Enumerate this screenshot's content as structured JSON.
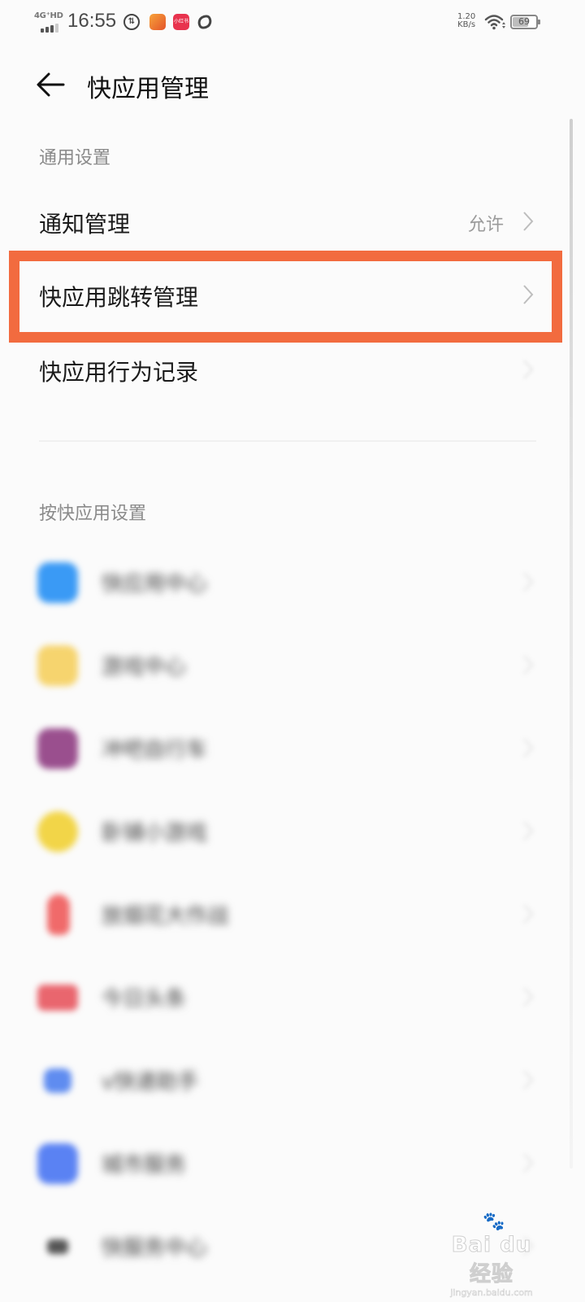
{
  "status_bar": {
    "network_label": "4G⁺HD",
    "time": "16:55",
    "speed_value": "1.20",
    "speed_unit": "KB/s",
    "battery_percent": 69,
    "battery_text": "69",
    "notification_icons": [
      "data-transfer-icon",
      "kuaishou-app-icon",
      "xiaohongshu-app-icon",
      "rugby-app-icon"
    ],
    "app2_label": "小红书"
  },
  "header": {
    "back_icon": "arrow-left-icon",
    "title": "快应用管理"
  },
  "general_section": {
    "label": "通用设置",
    "items": [
      {
        "label": "通知管理",
        "value": "允许"
      },
      {
        "label": "快应用跳转管理",
        "value": ""
      },
      {
        "label": "快应用行为记录",
        "value": ""
      }
    ]
  },
  "highlight": {
    "color": "#f26b3f",
    "target": "快应用跳转管理"
  },
  "apps_section": {
    "label": "按快应用设置",
    "apps": [
      {
        "name": "快应用中心",
        "icon_color": "#3a9af5"
      },
      {
        "name": "游戏中心",
        "icon_color": "#f6d46e"
      },
      {
        "name": "冲吧自行车",
        "icon_color": "#9a4f8e"
      },
      {
        "name": "卧铺小游戏",
        "icon_color": "#f2d548"
      },
      {
        "name": "放烟花大作战",
        "icon_color": "#f06a6a"
      },
      {
        "name": "今日头条",
        "icon_color": "#e9666e"
      },
      {
        "name": "v快递助手",
        "icon_color": "#5f8cf0"
      },
      {
        "name": "城市服务",
        "icon_color": "#5a82f3"
      },
      {
        "name": "快服务中心",
        "icon_color": "#555555"
      }
    ]
  },
  "watermark": {
    "main": "Bai du 经验",
    "sub": "jingyan.baidu.com"
  }
}
